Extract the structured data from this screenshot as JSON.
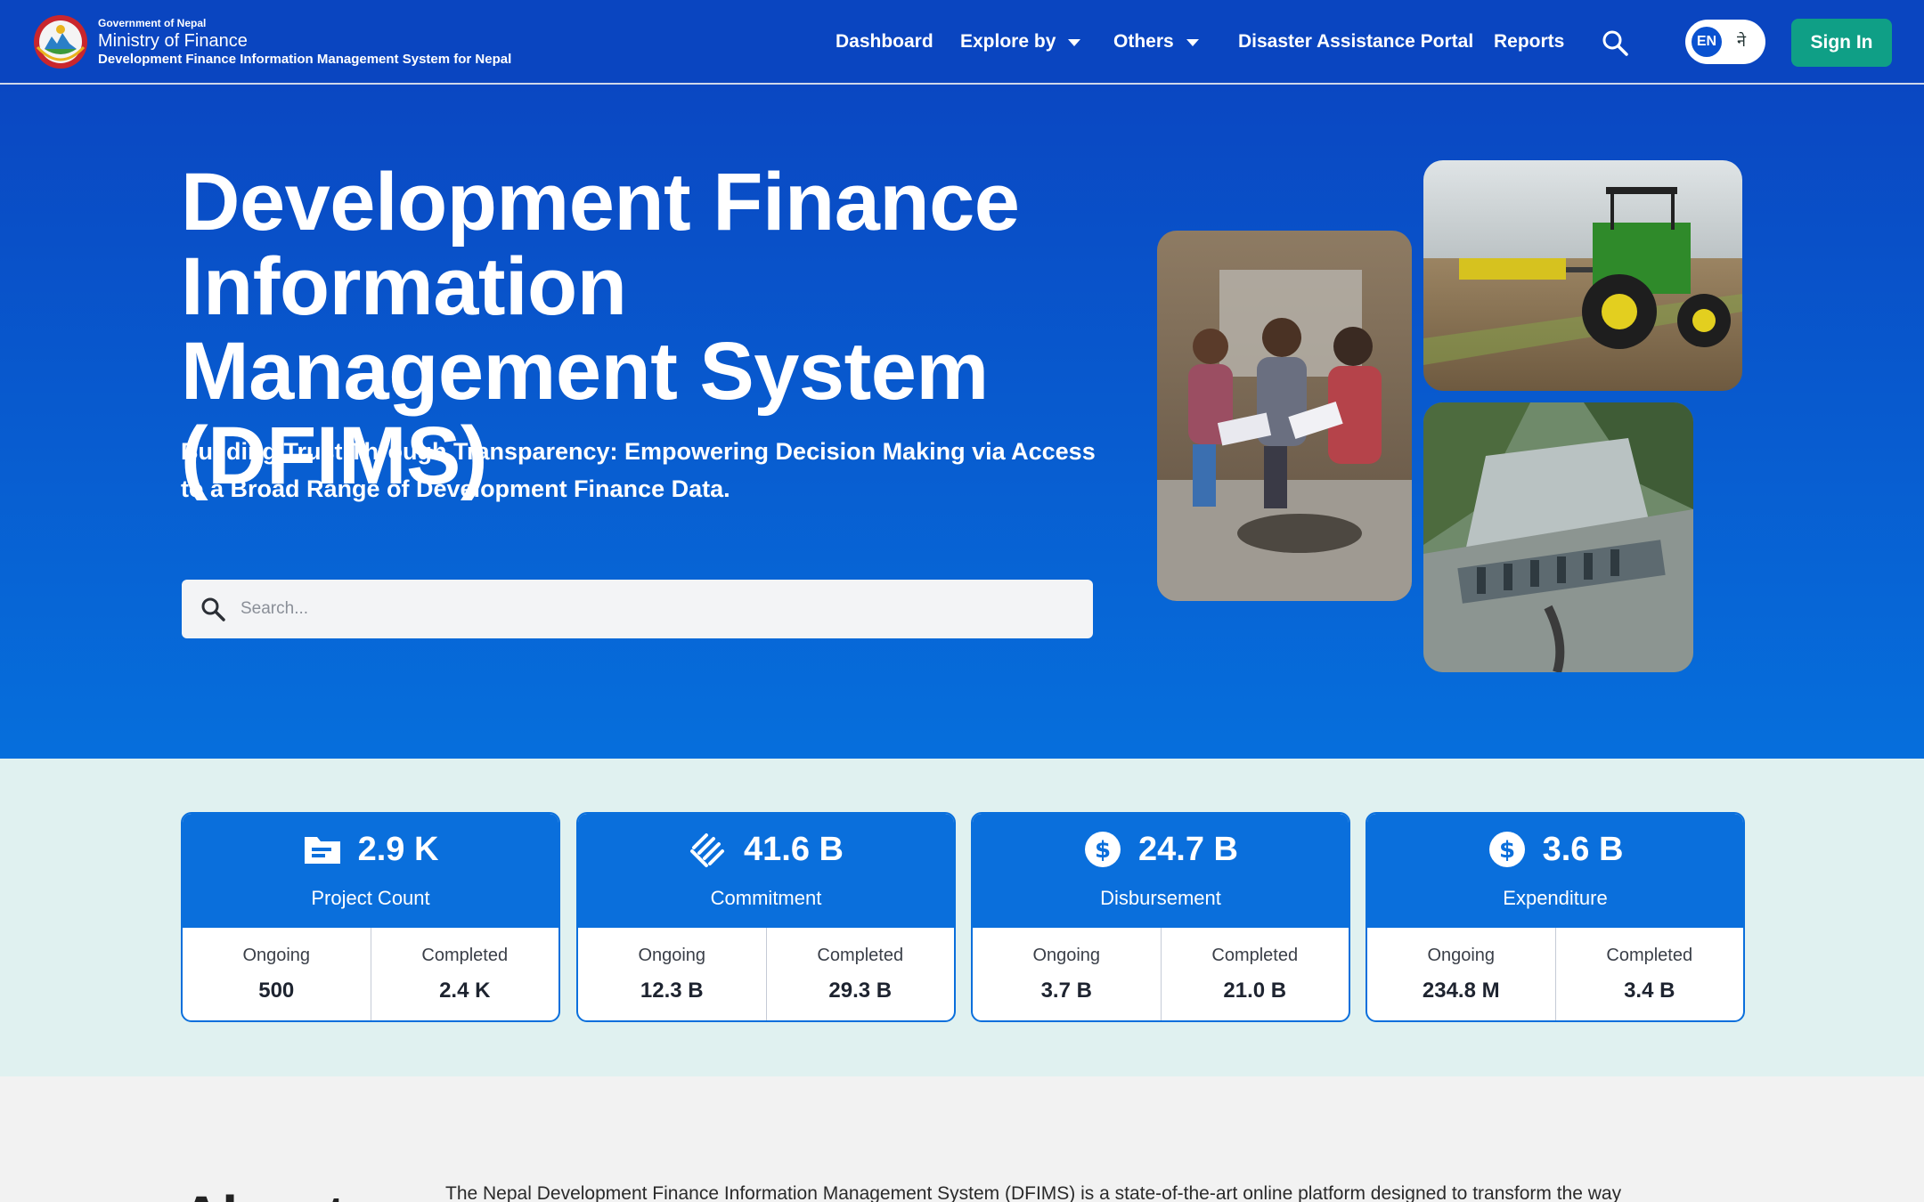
{
  "header": {
    "gov_label": "Government of Nepal",
    "ministry": "Ministry of Finance",
    "system_name": "Development Finance Information Management System for Nepal",
    "nav": {
      "dashboard": "Dashboard",
      "explore_by": "Explore by",
      "others": "Others",
      "disaster_portal": "Disaster Assistance Portal",
      "reports": "Reports"
    },
    "lang_en": "EN",
    "lang_ne": "ने",
    "sign_in": "Sign In",
    "search_icon": "search-icon",
    "colors": {
      "bar": "#0a45c0",
      "sign_in": "#0f9f86"
    }
  },
  "hero": {
    "title": "Development Finance Information Management System (DFIMS)",
    "subtitle": "Building Trust Through Transparency: Empowering Decision Making via Access to a Broad Range of Development Finance Data.",
    "search_placeholder": "Search..."
  },
  "stats": [
    {
      "icon": "folder-icon",
      "value": "2.9 K",
      "label": "Project Count",
      "ongoing_label": "Ongoing",
      "ongoing": "500",
      "completed_label": "Completed",
      "completed": "2.4 K"
    },
    {
      "icon": "handshake-icon",
      "value": "41.6 B",
      "label": "Commitment",
      "ongoing_label": "Ongoing",
      "ongoing": "12.3 B",
      "completed_label": "Completed",
      "completed": "29.3 B"
    },
    {
      "icon": "dollar-icon",
      "value": "24.7 B",
      "label": "Disbursement",
      "ongoing_label": "Ongoing",
      "ongoing": "3.7 B",
      "completed_label": "Completed",
      "completed": "21.0 B"
    },
    {
      "icon": "dollar-icon",
      "value": "3.6 B",
      "label": "Expenditure",
      "ongoing_label": "Ongoing",
      "ongoing": "234.8 M",
      "completed_label": "Completed",
      "completed": "3.4 B"
    }
  ],
  "about": {
    "heading": "About",
    "text": "The Nepal Development Finance Information Management System (DFIMS) is a state-of-the-art online platform designed to transform the way"
  }
}
